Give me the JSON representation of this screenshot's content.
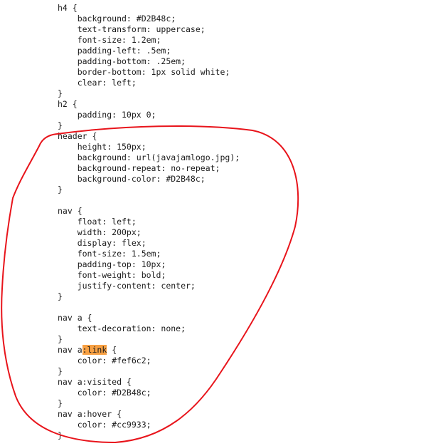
{
  "code": {
    "lines": [
      {
        "segments": [
          {
            "text": "h4 {"
          }
        ]
      },
      {
        "segments": [
          {
            "text": "    background: #D2B48c;"
          }
        ]
      },
      {
        "segments": [
          {
            "text": "    text-transform: uppercase;"
          }
        ]
      },
      {
        "segments": [
          {
            "text": "    font-size: 1.2em;"
          }
        ]
      },
      {
        "segments": [
          {
            "text": "    padding-left: .5em;"
          }
        ]
      },
      {
        "segments": [
          {
            "text": "    padding-bottom: .25em;"
          }
        ]
      },
      {
        "segments": [
          {
            "text": "    border-bottom: 1px solid white;"
          }
        ]
      },
      {
        "segments": [
          {
            "text": "    clear: left;"
          }
        ]
      },
      {
        "segments": [
          {
            "text": "}"
          }
        ]
      },
      {
        "segments": [
          {
            "text": "h2 {"
          }
        ]
      },
      {
        "segments": [
          {
            "text": "    padding: 10px 0;"
          }
        ]
      },
      {
        "segments": [
          {
            "text": "}"
          }
        ]
      },
      {
        "segments": [
          {
            "text": "header {"
          }
        ]
      },
      {
        "segments": [
          {
            "text": "    height: 150px;"
          }
        ]
      },
      {
        "segments": [
          {
            "text": "    background: url(javajamlogo.jpg);"
          }
        ]
      },
      {
        "segments": [
          {
            "text": "    background-repeat: no-repeat;"
          }
        ]
      },
      {
        "segments": [
          {
            "text": "    background-color: #D2B48c;"
          }
        ]
      },
      {
        "segments": [
          {
            "text": "}"
          }
        ]
      },
      {
        "segments": [
          {
            "text": ""
          }
        ]
      },
      {
        "segments": [
          {
            "text": "nav {"
          }
        ]
      },
      {
        "segments": [
          {
            "text": "    float: left;"
          }
        ]
      },
      {
        "segments": [
          {
            "text": "    width: 200px;"
          }
        ]
      },
      {
        "segments": [
          {
            "text": "    display: flex;"
          }
        ]
      },
      {
        "segments": [
          {
            "text": "    font-size: 1.5em;"
          }
        ]
      },
      {
        "segments": [
          {
            "text": "    padding-top: 10px;"
          }
        ]
      },
      {
        "segments": [
          {
            "text": "    font-weight: bold;"
          }
        ]
      },
      {
        "segments": [
          {
            "text": "    justify-content: center;"
          }
        ]
      },
      {
        "segments": [
          {
            "text": "}"
          }
        ]
      },
      {
        "segments": [
          {
            "text": ""
          }
        ]
      },
      {
        "segments": [
          {
            "text": "nav a {"
          }
        ]
      },
      {
        "segments": [
          {
            "text": "    text-decoration: none;"
          }
        ]
      },
      {
        "segments": [
          {
            "text": "}"
          }
        ]
      },
      {
        "segments": [
          {
            "text": "nav a"
          },
          {
            "text": ":link",
            "highlight": true
          },
          {
            "text": " {"
          }
        ]
      },
      {
        "segments": [
          {
            "text": "    color: #fef6c2;"
          }
        ]
      },
      {
        "segments": [
          {
            "text": "}"
          }
        ]
      },
      {
        "segments": [
          {
            "text": "nav a:visited {"
          }
        ]
      },
      {
        "segments": [
          {
            "text": "    color: #D2B48c;"
          }
        ]
      },
      {
        "segments": [
          {
            "text": "}"
          }
        ]
      },
      {
        "segments": [
          {
            "text": "nav a:hover {"
          }
        ]
      },
      {
        "segments": [
          {
            "text": "    color: #cc9933;"
          }
        ]
      },
      {
        "segments": [
          {
            "text": "}"
          }
        ]
      }
    ]
  },
  "colors": {
    "text": "#1a1a1a",
    "search_highlight": "#f7a043",
    "annotation_circle": "#e8141b"
  }
}
